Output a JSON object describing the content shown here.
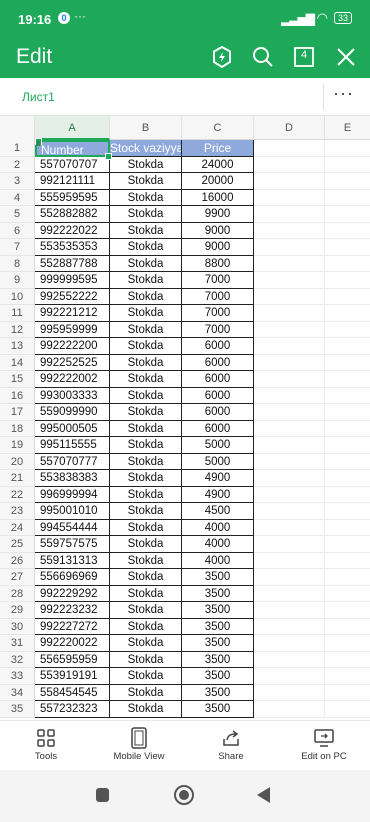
{
  "status_bar": {
    "time": "19:16",
    "indicator": "0",
    "dots": "···",
    "battery": "33"
  },
  "app_bar": {
    "title": "Edit",
    "icons": [
      "shield-icon",
      "search-icon",
      "tab-count-icon",
      "close-icon"
    ],
    "tab_count": "4"
  },
  "sheet_bar": {
    "sheet_name": "Лист1",
    "more": "···"
  },
  "columns": [
    "A",
    "B",
    "C",
    "D",
    "E"
  ],
  "header_row": {
    "row": "1",
    "a": "Number",
    "b": "Stock vaziyyati",
    "c": "Price"
  },
  "rows": [
    {
      "n": "2",
      "a": "557070707",
      "b": "Stokda",
      "c": "24000"
    },
    {
      "n": "3",
      "a": "992121111",
      "b": "Stokda",
      "c": "20000"
    },
    {
      "n": "4",
      "a": "555959595",
      "b": "Stokda",
      "c": "16000"
    },
    {
      "n": "5",
      "a": "552882882",
      "b": "Stokda",
      "c": "9900"
    },
    {
      "n": "6",
      "a": "992222022",
      "b": "Stokda",
      "c": "9000"
    },
    {
      "n": "7",
      "a": "553535353",
      "b": "Stokda",
      "c": "9000"
    },
    {
      "n": "8",
      "a": "552887788",
      "b": "Stokda",
      "c": "8800"
    },
    {
      "n": "9",
      "a": "999999595",
      "b": "Stokda",
      "c": "7000"
    },
    {
      "n": "10",
      "a": "992552222",
      "b": "Stokda",
      "c": "7000"
    },
    {
      "n": "11",
      "a": "992221212",
      "b": "Stokda",
      "c": "7000"
    },
    {
      "n": "12",
      "a": "995959999",
      "b": "Stokda",
      "c": "7000"
    },
    {
      "n": "13",
      "a": "992222200",
      "b": "Stokda",
      "c": "6000"
    },
    {
      "n": "14",
      "a": "992252525",
      "b": "Stokda",
      "c": "6000"
    },
    {
      "n": "15",
      "a": "992222002",
      "b": "Stokda",
      "c": "6000"
    },
    {
      "n": "16",
      "a": "993003333",
      "b": "Stokda",
      "c": "6000"
    },
    {
      "n": "17",
      "a": "559099990",
      "b": "Stokda",
      "c": "6000"
    },
    {
      "n": "18",
      "a": "995000505",
      "b": "Stokda",
      "c": "6000"
    },
    {
      "n": "19",
      "a": "995115555",
      "b": "Stokda",
      "c": "5000"
    },
    {
      "n": "20",
      "a": "557070777",
      "b": "Stokda",
      "c": "5000"
    },
    {
      "n": "21",
      "a": "553838383",
      "b": "Stokda",
      "c": "4900"
    },
    {
      "n": "22",
      "a": "996999994",
      "b": "Stokda",
      "c": "4900"
    },
    {
      "n": "23",
      "a": "995001010",
      "b": "Stokda",
      "c": "4500"
    },
    {
      "n": "24",
      "a": "994554444",
      "b": "Stokda",
      "c": "4000"
    },
    {
      "n": "25",
      "a": "559757575",
      "b": "Stokda",
      "c": "4000"
    },
    {
      "n": "26",
      "a": "559131313",
      "b": "Stokda",
      "c": "4000"
    },
    {
      "n": "27",
      "a": "556696969",
      "b": "Stokda",
      "c": "3500"
    },
    {
      "n": "28",
      "a": "992229292",
      "b": "Stokda",
      "c": "3500"
    },
    {
      "n": "29",
      "a": "992223232",
      "b": "Stokda",
      "c": "3500"
    },
    {
      "n": "30",
      "a": "992227272",
      "b": "Stokda",
      "c": "3500"
    },
    {
      "n": "31",
      "a": "992220022",
      "b": "Stokda",
      "c": "3500"
    },
    {
      "n": "32",
      "a": "556595959",
      "b": "Stokda",
      "c": "3500"
    },
    {
      "n": "33",
      "a": "553919191",
      "b": "Stokda",
      "c": "3500"
    },
    {
      "n": "34",
      "a": "558454545",
      "b": "Stokda",
      "c": "3500"
    },
    {
      "n": "35",
      "a": "557232323",
      "b": "Stokda",
      "c": "3500"
    }
  ],
  "bottom_bar": [
    {
      "name": "tools",
      "label": "Tools",
      "icon": "tools-icon"
    },
    {
      "name": "mobile-view",
      "label": "Mobile View",
      "icon": "mobile-view-icon"
    },
    {
      "name": "share",
      "label": "Share",
      "icon": "share-icon"
    },
    {
      "name": "edit-on-pc",
      "label": "Edit on PC",
      "icon": "edit-on-pc-icon"
    }
  ],
  "colors": {
    "accent": "#1ea85a",
    "header_fill": "#8fa9dc"
  }
}
